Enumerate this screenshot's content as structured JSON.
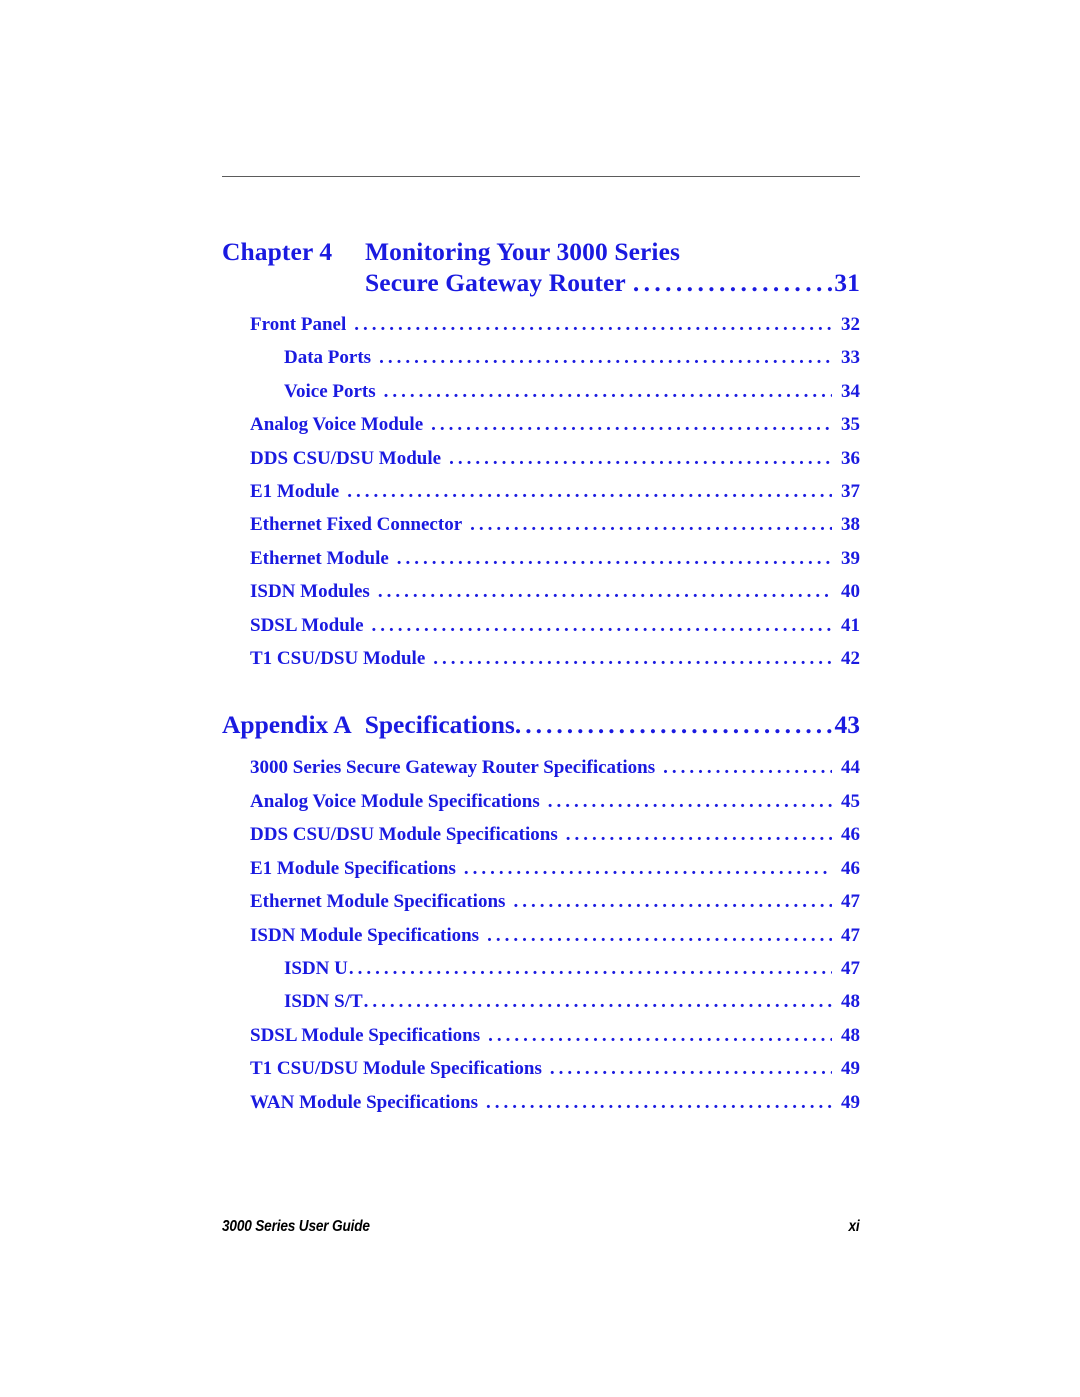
{
  "document": {
    "title": "3000 Series User Guide Table of Contents",
    "accent_color": "#1a1ae0",
    "rule_color": "#5b5b5b",
    "footer_color": "#000000"
  },
  "chapter": {
    "label": "Chapter 4",
    "title_line1": "Monitoring Your 3000 Series",
    "title_line2": "Secure Gateway Router",
    "page": "31"
  },
  "chapter_entries": [
    {
      "text": "Front Panel",
      "page": "32",
      "level": 1
    },
    {
      "text": "Data Ports",
      "page": "33",
      "level": 2
    },
    {
      "text": "Voice Ports",
      "page": "34",
      "level": 2
    },
    {
      "text": "Analog Voice Module",
      "page": "35",
      "level": 1
    },
    {
      "text": "DDS CSU/DSU Module",
      "page": "36",
      "level": 1
    },
    {
      "text": "E1 Module",
      "page": "37",
      "level": 1
    },
    {
      "text": "Ethernet Fixed Connector",
      "page": "38",
      "level": 1
    },
    {
      "text": "Ethernet Module",
      "page": "39",
      "level": 1
    },
    {
      "text": "ISDN Modules",
      "page": "40",
      "level": 1
    },
    {
      "text": "SDSL Module",
      "page": "41",
      "level": 1
    },
    {
      "text": "T1 CSU/DSU Module",
      "page": "42",
      "level": 1
    }
  ],
  "appendix": {
    "label": "Appendix A",
    "title": "Specifications",
    "page": "43"
  },
  "appendix_entries": [
    {
      "text": "3000 Series Secure Gateway Router Specifications",
      "page": "44",
      "level": 1
    },
    {
      "text": "Analog Voice Module Specifications",
      "page": "45",
      "level": 1
    },
    {
      "text": "DDS CSU/DSU Module Specifications",
      "page": "46",
      "level": 1
    },
    {
      "text": "E1 Module Specifications",
      "page": "46",
      "level": 1
    },
    {
      "text": "Ethernet Module Specifications",
      "page": "47",
      "level": 1
    },
    {
      "text": "ISDN Module Specifications",
      "page": "47",
      "level": 1
    },
    {
      "text": "ISDN U",
      "page": "47",
      "level": 2,
      "tight": true
    },
    {
      "text": "ISDN S/T",
      "page": "48",
      "level": 2,
      "tight": true
    },
    {
      "text": "SDSL Module Specifications",
      "page": "48",
      "level": 1
    },
    {
      "text": "T1 CSU/DSU Module Specifications",
      "page": "49",
      "level": 1
    },
    {
      "text": "WAN Module Specifications",
      "page": "49",
      "level": 1
    }
  ],
  "footer": {
    "left": "3000 Series User Guide",
    "right": "xi"
  }
}
